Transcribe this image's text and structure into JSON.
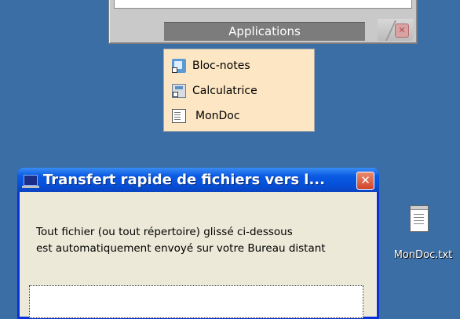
{
  "apps_panel": {
    "title": "Applications",
    "close_icon": "close-icon"
  },
  "menu": {
    "items": [
      {
        "label": "Bloc-notes",
        "icon": "notepad-icon"
      },
      {
        "label": "Calculatrice",
        "icon": "calculator-icon"
      },
      {
        "label": "MonDoc",
        "icon": "text-document-icon"
      }
    ]
  },
  "dialog": {
    "title": "Transfert rapide de fichiers vers l...",
    "close_label": "✕",
    "message_line1": "Tout fichier (ou tout répertoire) glissé ci-dessous",
    "message_line2": "est automatiquement envoyé sur votre Bureau distant"
  },
  "desktop": {
    "file_label": "MonDoc.txt",
    "background_color": "#3a6ea5"
  }
}
